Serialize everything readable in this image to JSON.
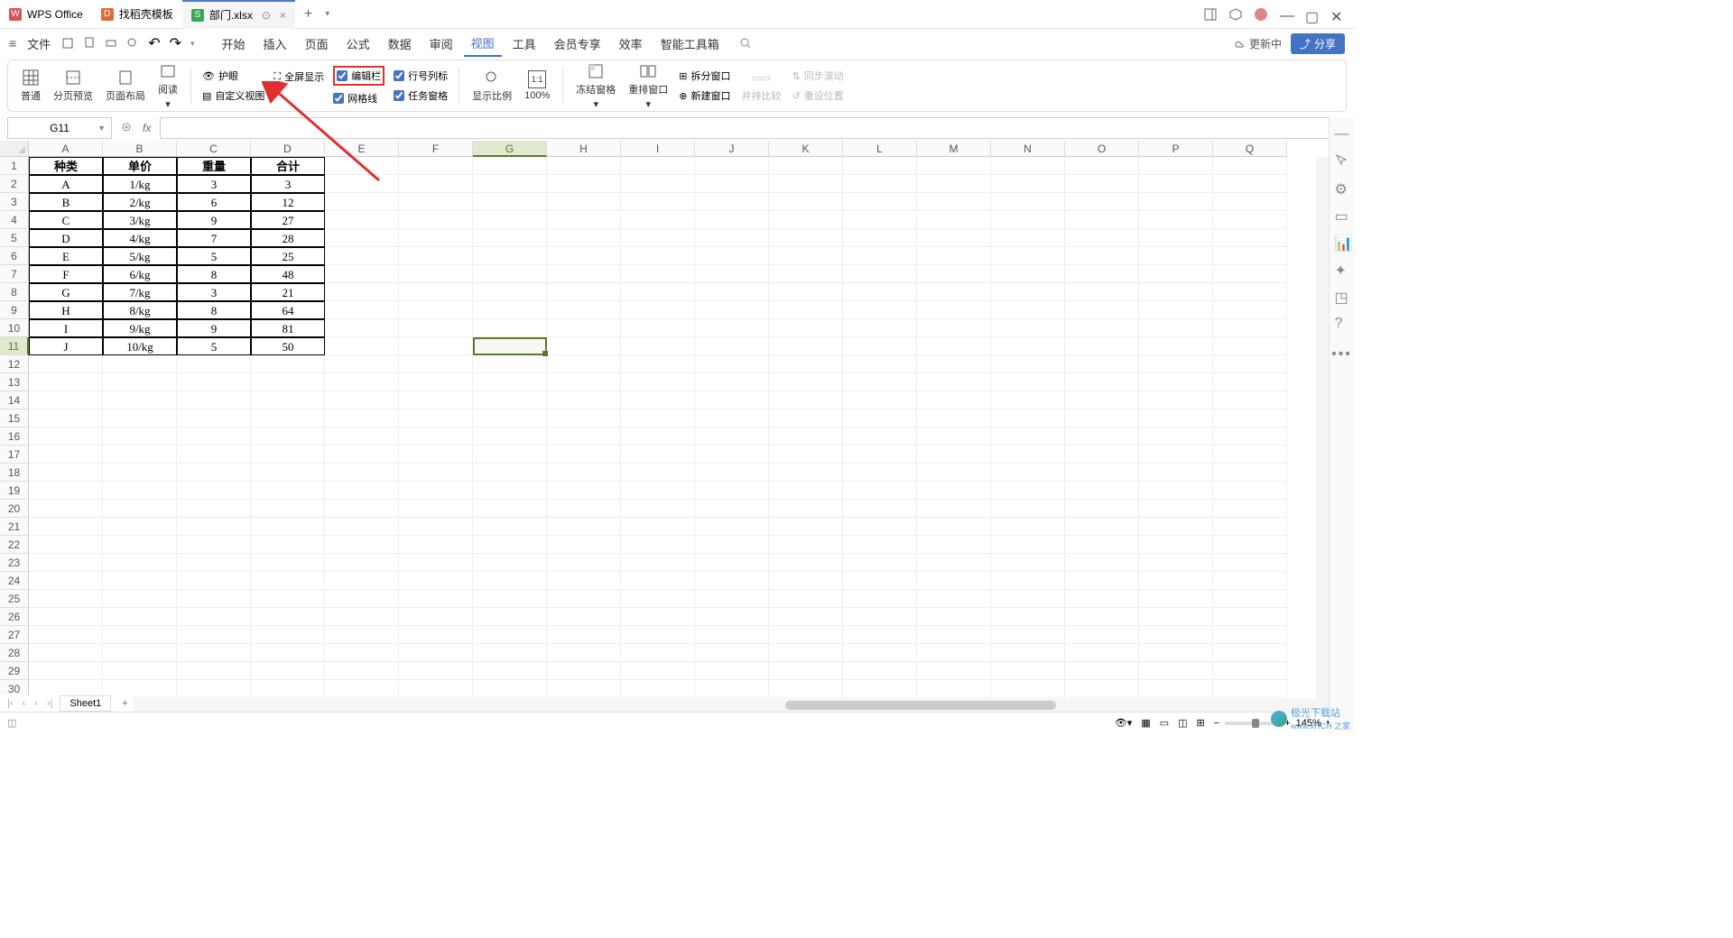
{
  "titlebar": {
    "tabs": [
      {
        "label": "WPS Office",
        "icon_bg": "#d9534f",
        "icon_txt": "W"
      },
      {
        "label": "找稻壳模板",
        "icon_bg": "#e06a3a",
        "icon_txt": "D"
      },
      {
        "label": "部门.xlsx",
        "icon_bg": "#3aa655",
        "icon_txt": "S",
        "active": true
      }
    ]
  },
  "menubar": {
    "file": "文件",
    "items": [
      "开始",
      "插入",
      "页面",
      "公式",
      "数据",
      "审阅",
      "视图",
      "工具",
      "会员专享",
      "效率",
      "智能工具箱"
    ],
    "active": "视图",
    "update": "更新中",
    "share": "分享"
  },
  "ribbon": {
    "normal": "普通",
    "page_preview": "分页预览",
    "page_layout": "页面布局",
    "read": "阅读",
    "eye": "护眼",
    "fullscreen": "全屏显示",
    "custom_view": "自定义视图",
    "edit_bar": "编辑栏",
    "gridlines": "网格线",
    "row_col_label": "行号列标",
    "task_pane": "任务窗格",
    "zoom_ratio": "显示比例",
    "hundred": "100%",
    "freeze": "冻结窗格",
    "rearrange": "重排窗口",
    "split": "拆分窗口",
    "new_window": "新建窗口",
    "side_compare": "并排比较",
    "sync_scroll": "同步滚动",
    "reset_pos": "重设位置"
  },
  "formula_bar": {
    "cell_ref": "G11",
    "fx": "fx"
  },
  "grid": {
    "columns": [
      "A",
      "B",
      "C",
      "D",
      "E",
      "F",
      "G",
      "H",
      "I",
      "J",
      "K",
      "L",
      "M",
      "N",
      "O",
      "P",
      "Q"
    ],
    "row_count": 30,
    "selected_col": "G",
    "selected_row": 11,
    "headers": [
      "种类",
      "单价",
      "重量",
      "合计"
    ],
    "data": [
      [
        "A",
        "1/kg",
        "3",
        "3"
      ],
      [
        "B",
        "2/kg",
        "6",
        "12"
      ],
      [
        "C",
        "3/kg",
        "9",
        "27"
      ],
      [
        "D",
        "4/kg",
        "7",
        "28"
      ],
      [
        "E",
        "5/kg",
        "5",
        "25"
      ],
      [
        "F",
        "6/kg",
        "8",
        "48"
      ],
      [
        "G",
        "7/kg",
        "3",
        "21"
      ],
      [
        "H",
        "8/kg",
        "8",
        "64"
      ],
      [
        "I",
        "9/kg",
        "9",
        "81"
      ],
      [
        "J",
        "10/kg",
        "5",
        "50"
      ]
    ]
  },
  "sheet": {
    "name": "Sheet1"
  },
  "status": {
    "zoom": "145%"
  },
  "watermark": {
    "text1": "极光下载站",
    "text2": "www.xHCH 之家"
  }
}
